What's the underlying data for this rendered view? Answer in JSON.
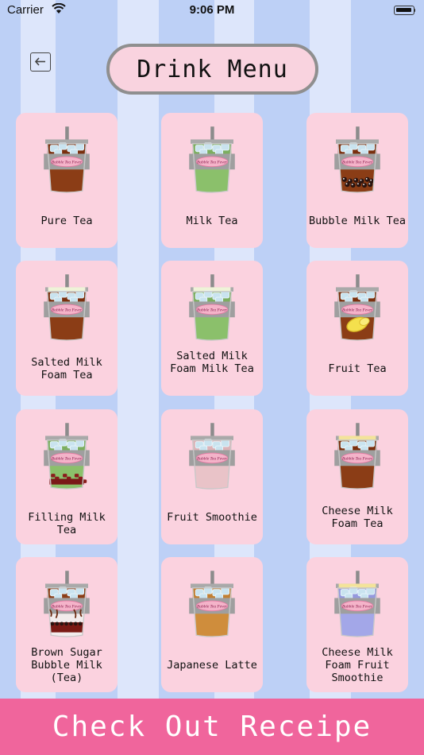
{
  "status_bar": {
    "carrier": "Carrier",
    "time": "9:06 PM"
  },
  "header": {
    "title": "Drink Menu",
    "back_icon": "back-arrow-icon"
  },
  "cup_logo_text": "Bubble Tea Fever",
  "drinks": [
    {
      "label": "Pure Tea",
      "liquid": "#8b3d16",
      "top": "#7a2f0e"
    },
    {
      "label": "Milk Tea",
      "liquid": "#8bc06b",
      "top": "#7cae60"
    },
    {
      "label": "Bubble Milk Tea",
      "liquid": "#8b3d16",
      "top": "#7a2f0e",
      "topping": "pearls"
    },
    {
      "label": "Salted Milk Foam Tea",
      "liquid": "#8b3d16",
      "top": "#7a2f0e",
      "foam": "#eff3d8"
    },
    {
      "label": "Salted Milk Foam Milk Tea",
      "liquid": "#8bc06b",
      "top": "#7cae60",
      "foam": "#eff3d8"
    },
    {
      "label": "Fruit Tea",
      "liquid": "#8b3d16",
      "top": "#7a2f0e",
      "topping": "lemon"
    },
    {
      "label": "Filling Milk Tea",
      "liquid": "#8bc06b",
      "top": "#7cae60",
      "topping": "filling"
    },
    {
      "label": "Fruit Smoothie",
      "liquid": "#e9c3c8",
      "top": "#dcb3b8"
    },
    {
      "label": "Cheese Milk Foam Tea",
      "liquid": "#8b3d16",
      "top": "#7a2f0e",
      "foam": "#f3e39a"
    },
    {
      "label": "Brown Sugar Bubble Milk (Tea)",
      "liquid": "#f2ecec",
      "top": "#8b3d16",
      "topping": "brownsugar"
    },
    {
      "label": "Japanese Latte",
      "liquid": "#cf8d3c",
      "top": "#c27f32"
    },
    {
      "label": "Cheese Milk Foam Fruit Smoothie",
      "liquid": "#a3a7e8",
      "top": "#9599dd",
      "foam": "#f3e39a"
    }
  ],
  "footer": {
    "checkout_label": "Check Out Receipe"
  },
  "colors": {
    "background": "#dde6fb",
    "stripe": "#bdd0f6",
    "card": "#fbd2df",
    "checkout": "#f0659c",
    "title_pill": "#f9d3df"
  }
}
